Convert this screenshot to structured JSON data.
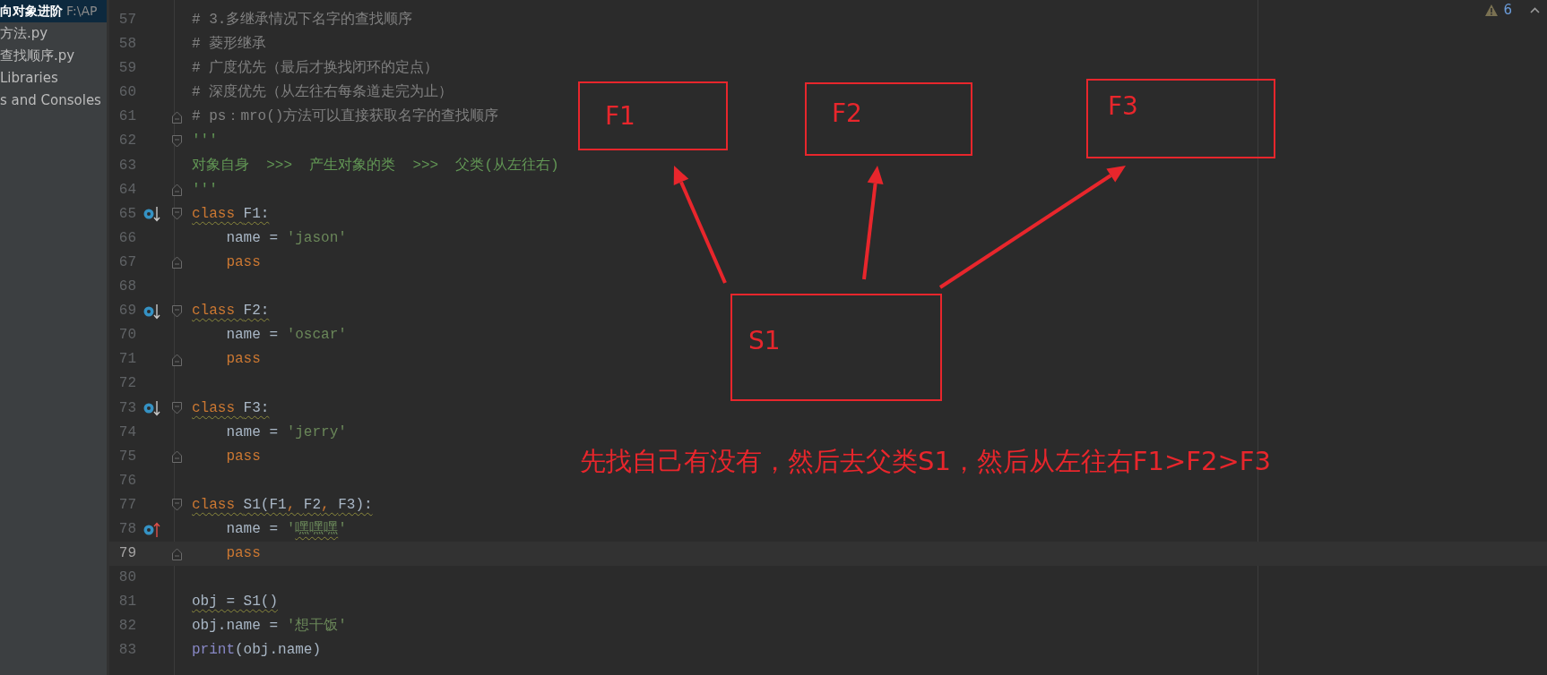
{
  "sidebar": {
    "items": [
      {
        "text": "向对象进阶",
        "path": "F:\\AP",
        "selected": true
      },
      {
        "text": "方法.py",
        "selected": false
      },
      {
        "text": "查找顺序.py",
        "selected": false
      },
      {
        "text": "Libraries",
        "selected": false
      },
      {
        "text": "s and Consoles",
        "selected": false
      }
    ]
  },
  "inspections": {
    "count": "6"
  },
  "editor": {
    "lines": [
      {
        "number": "57",
        "tokens": [
          {
            "kind": "comment",
            "text": "# 3.多继承情况下名字的查找顺序"
          }
        ]
      },
      {
        "number": "58",
        "tokens": [
          {
            "kind": "comment",
            "text": "# 菱形继承"
          }
        ]
      },
      {
        "number": "59",
        "tokens": [
          {
            "kind": "comment",
            "text": "# 广度优先（最后才换找闭环的定点）"
          }
        ]
      },
      {
        "number": "60",
        "tokens": [
          {
            "kind": "comment",
            "text": "# 深度优先（从左往右每条道走完为止）"
          }
        ]
      },
      {
        "number": "61",
        "fold_end": true,
        "tokens": [
          {
            "kind": "comment",
            "text": "# ps：mro()方法可以直接获取名字的查找顺序"
          }
        ]
      },
      {
        "number": "62",
        "fold_start": true,
        "tokens": [
          {
            "kind": "docstring",
            "text": "'''"
          }
        ]
      },
      {
        "number": "63",
        "tokens": [
          {
            "kind": "docstring",
            "text": "对象自身  >>>  产生对象的类  >>>  父类(从左往右)"
          }
        ]
      },
      {
        "number": "64",
        "fold_end": true,
        "tokens": [
          {
            "kind": "docstring",
            "text": "'''"
          }
        ]
      },
      {
        "number": "65",
        "implemented_marker": true,
        "fold_start": true,
        "tokens": [
          {
            "kind": "keyword",
            "text": "class ",
            "wavy": true
          },
          {
            "kind": "ident",
            "text": "F1:",
            "wavy": true
          }
        ]
      },
      {
        "number": "66",
        "tokens": [
          {
            "kind": "ident",
            "text": "    name = "
          },
          {
            "kind": "string",
            "text": "'jason'"
          }
        ]
      },
      {
        "number": "67",
        "fold_end": true,
        "tokens": [
          {
            "kind": "keyword",
            "text": "    pass"
          }
        ]
      },
      {
        "number": "68"
      },
      {
        "number": "69",
        "implemented_marker": true,
        "fold_start": true,
        "tokens": [
          {
            "kind": "keyword",
            "text": "class ",
            "wavy": true
          },
          {
            "kind": "ident",
            "text": "F2:",
            "wavy": true
          }
        ]
      },
      {
        "number": "70",
        "tokens": [
          {
            "kind": "ident",
            "text": "    name = "
          },
          {
            "kind": "string",
            "text": "'oscar'"
          }
        ]
      },
      {
        "number": "71",
        "fold_end": true,
        "tokens": [
          {
            "kind": "keyword",
            "text": "    pass"
          }
        ]
      },
      {
        "number": "72"
      },
      {
        "number": "73",
        "implemented_marker": true,
        "fold_start": true,
        "tokens": [
          {
            "kind": "keyword",
            "text": "class ",
            "wavy": true
          },
          {
            "kind": "ident",
            "text": "F3:",
            "wavy": true
          }
        ]
      },
      {
        "number": "74",
        "tokens": [
          {
            "kind": "ident",
            "text": "    name = "
          },
          {
            "kind": "string",
            "text": "'jerry'"
          }
        ]
      },
      {
        "number": "75",
        "fold_end": true,
        "tokens": [
          {
            "kind": "keyword",
            "text": "    pass"
          }
        ]
      },
      {
        "number": "76"
      },
      {
        "number": "77",
        "fold_start": true,
        "tokens": [
          {
            "kind": "keyword",
            "text": "class ",
            "wavy": true
          },
          {
            "kind": "ident",
            "text": "S1(F1",
            "wavy": true
          },
          {
            "kind": "keyword",
            "text": ", ",
            "wavy": true
          },
          {
            "kind": "ident",
            "text": "F2",
            "wavy": true
          },
          {
            "kind": "keyword",
            "text": ", ",
            "wavy": true
          },
          {
            "kind": "ident",
            "text": "F3):",
            "wavy": true
          }
        ]
      },
      {
        "number": "78",
        "override_marker": true,
        "tokens": [
          {
            "kind": "ident",
            "text": "    name = "
          },
          {
            "kind": "string",
            "text": "'"
          },
          {
            "kind": "string",
            "text": "嘿嘿嘿",
            "wavy": true
          },
          {
            "kind": "string",
            "text": "'"
          }
        ]
      },
      {
        "number": "79",
        "current": true,
        "fold_end": true,
        "tokens": [
          {
            "kind": "keyword",
            "text": "    pass"
          }
        ]
      },
      {
        "number": "80"
      },
      {
        "number": "81",
        "tokens": [
          {
            "kind": "ident",
            "text": "obj = S1()",
            "wavy": true
          }
        ]
      },
      {
        "number": "82",
        "tokens": [
          {
            "kind": "ident",
            "text": "obj.name = "
          },
          {
            "kind": "string",
            "text": "'想干饭'"
          }
        ]
      },
      {
        "number": "83",
        "tokens": [
          {
            "kind": "builtin",
            "text": "print"
          },
          {
            "kind": "ident",
            "text": "(obj.name)"
          }
        ]
      }
    ]
  },
  "annotation": {
    "boxes": [
      {
        "label": "F1",
        "kind": "parent"
      },
      {
        "label": "F2",
        "kind": "parent"
      },
      {
        "label": "F3",
        "kind": "parent"
      },
      {
        "label": "S1",
        "kind": "child"
      }
    ],
    "note": "先找自己有没有，然后去父类S1，然后从左往右F1>F2>F3"
  }
}
